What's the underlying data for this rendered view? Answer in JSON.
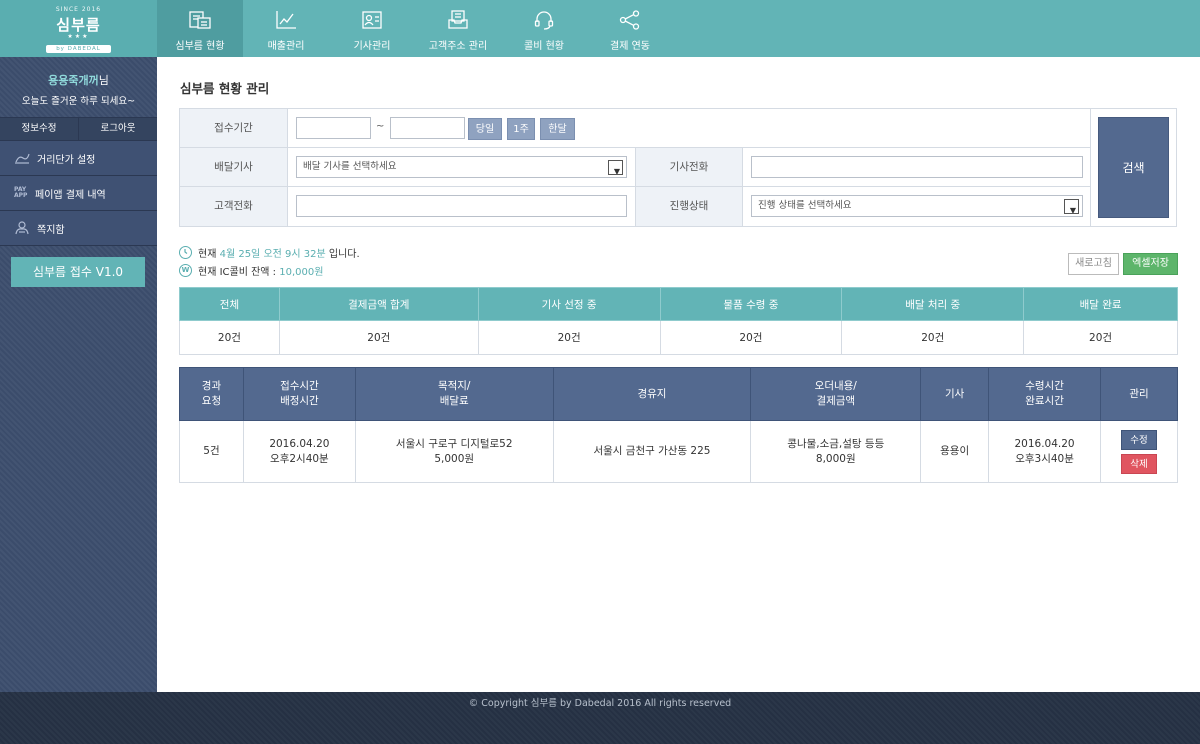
{
  "logo": {
    "since": "SINCE 2016",
    "name": "심부름",
    "stars": "★★★",
    "by": "by DABEDAL"
  },
  "nav": [
    {
      "label": "심부름 현황",
      "icon": "order-list-icon",
      "active": true
    },
    {
      "label": "매출관리",
      "icon": "line-chart-icon"
    },
    {
      "label": "기사관리",
      "icon": "id-card-icon"
    },
    {
      "label": "고객주소 관리",
      "icon": "address-box-icon"
    },
    {
      "label": "콜비 현황",
      "icon": "headset-icon"
    },
    {
      "label": "결제 연동",
      "icon": "share-nodes-icon"
    }
  ],
  "sidebar": {
    "user": "용용죽개꺼",
    "user_suffix": "님",
    "greeting": "오늘도 즐거운 하루 되세요~",
    "account": {
      "edit": "정보수정",
      "logout": "로그아웃"
    },
    "items": [
      {
        "label": "거리단가 설정",
        "icon": "distance-chart-icon"
      },
      {
        "label": "페이앱 결제 내역",
        "icon": "payapp-icon",
        "icon_text": "PAY APP"
      },
      {
        "label": "쪽지함",
        "icon": "message-icon"
      }
    ],
    "version_button": "심부름 접수 V1.0"
  },
  "main": {
    "title": "심부름 현황 관리",
    "search": {
      "period_label": "접수기간",
      "tilde": "~",
      "period_buttons": [
        "당일",
        "1주",
        "한달"
      ],
      "driver_label": "배달기사",
      "driver_placeholder": "배달 기사를 선택하세요",
      "driver_phone_label": "기사전화",
      "customer_phone_label": "고객전화",
      "status_label": "진행상태",
      "status_placeholder": "진행 상태를 선택하세요",
      "search_button": "검색"
    },
    "info": {
      "now_prefix": "현재",
      "now_value": "4월 25일 오전 9시 32분",
      "now_suffix": "입니다.",
      "balance_prefix": "현재 IC콜비 잔액 :",
      "balance_value": "10,000원",
      "balance_icon_text": "W"
    },
    "buttons": {
      "refresh": "새로고침",
      "excel": "엑셀저장"
    },
    "stats": {
      "headers": [
        "전체",
        "결제금액 합계",
        "기사 선정 중",
        "물품 수령 중",
        "배달 처리 중",
        "배달 완료"
      ],
      "values": [
        "20건",
        "20건",
        "20건",
        "20건",
        "20건",
        "20건"
      ]
    },
    "orders": {
      "headers": [
        [
          "경과",
          "요청"
        ],
        [
          "접수시간",
          "배정시간"
        ],
        [
          "목적지/",
          "배달료"
        ],
        [
          "경유지"
        ],
        [
          "오더내용/",
          "결제금액"
        ],
        [
          "기사"
        ],
        [
          "수령시간",
          "완료시간"
        ],
        [
          "관리"
        ]
      ],
      "rows": [
        {
          "elapsed": "5건",
          "received": "2016.04.20",
          "assigned": "오후2시40분",
          "destination": "서울시 구로구 디지털로52",
          "fee": "5,000원",
          "waypoint": "서울시 금천구 가산동 225",
          "content": "콩나물,소금,설탕 등등",
          "amount": "8,000원",
          "driver": "용용이",
          "pickup": "2016.04.20",
          "done": "오후3시40분",
          "edit": "수정",
          "delete": "삭제"
        }
      ]
    }
  },
  "footer": "© Copyright 심부름 by Dabedal 2016 All rights reserved"
}
